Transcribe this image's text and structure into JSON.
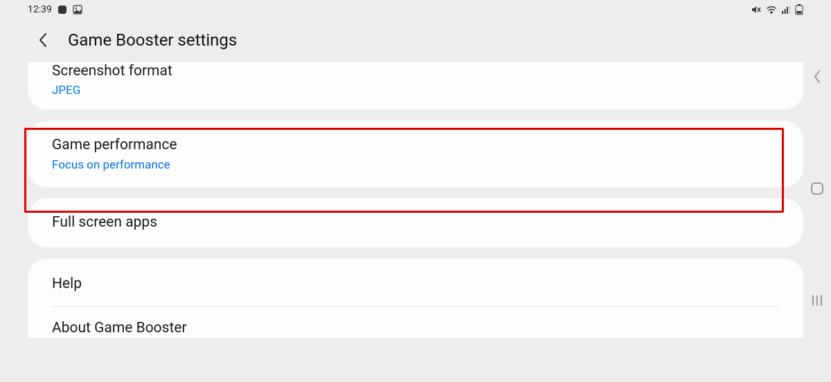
{
  "statusBar": {
    "time": "12:39"
  },
  "header": {
    "title": "Game Booster settings"
  },
  "items": {
    "screenshotFormat": {
      "title": "Screenshot format",
      "subtitle": "JPEG"
    },
    "gamePerformance": {
      "title": "Game performance",
      "subtitle": "Focus on performance"
    },
    "fullScreenApps": {
      "title": "Full screen apps"
    },
    "help": {
      "title": "Help"
    },
    "about": {
      "title": "About Game Booster"
    }
  }
}
